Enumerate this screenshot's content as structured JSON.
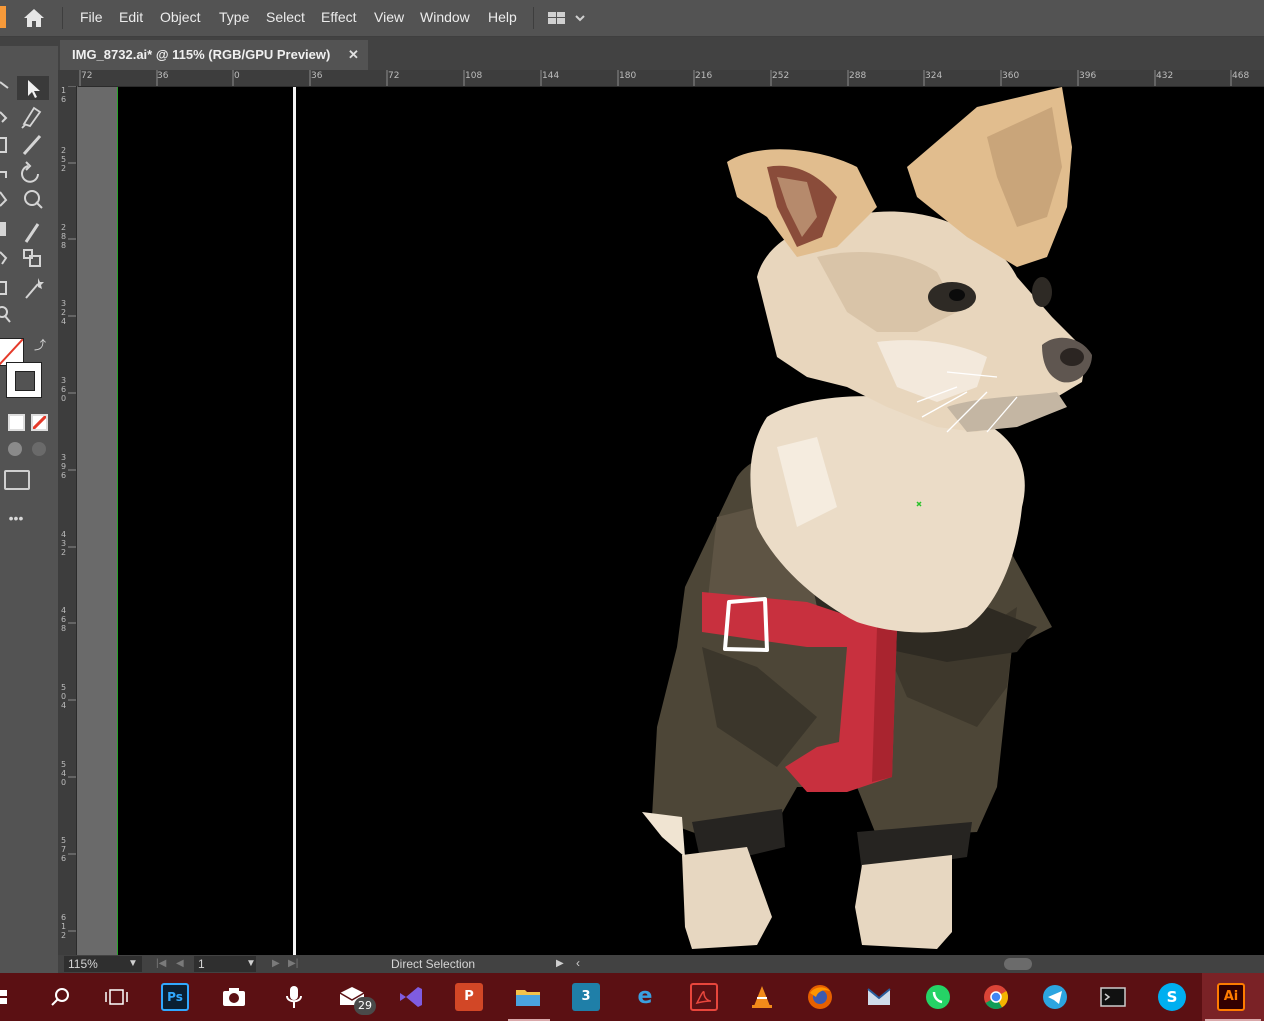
{
  "menubar": {
    "items": [
      "File",
      "Edit",
      "Object",
      "Type",
      "Select",
      "Effect",
      "View",
      "Window",
      "Help"
    ]
  },
  "document": {
    "tab_title": "IMG_8732.ai* @ 115% (RGB/GPU Preview)",
    "close_glyph": "✕"
  },
  "ruler": {
    "top_labels": [
      "72",
      "36",
      "0",
      "36",
      "72",
      "108",
      "144",
      "180",
      "216",
      "252",
      "288",
      "324",
      "360",
      "396",
      "432",
      "468"
    ],
    "left_labels": [
      "1\n6",
      "2\n5\n2",
      "2\n8\n8",
      "3\n2\n4",
      "3\n6\n0",
      "3\n9\n6",
      "4\n3\n2",
      "4\n6\n8",
      "5\n0\n4",
      "5\n4\n0",
      "5\n7\n6",
      "6\n1\n2"
    ]
  },
  "toolbar": {
    "tools": [
      "selection-tool",
      "direct-selection-tool",
      "pen-tool",
      "curvature-tool",
      "rectangle-tool",
      "paintbrush-tool",
      "rotate-tool",
      "scale-tool",
      "width-tool",
      "free-transform-tool",
      "shape-builder-tool",
      "eyedropper-tool",
      "blend-tool",
      "symbol-sprayer-tool",
      "artboard-tool",
      "slice-tool",
      "zoom-tool"
    ],
    "more_label": "•••"
  },
  "status": {
    "zoom": "115%",
    "page": "1",
    "tool_name": "Direct Selection"
  },
  "taskbar": {
    "mail_badge": "29",
    "icons": [
      "windows-start",
      "search",
      "task-view",
      "photoshop",
      "camera",
      "voice-recorder",
      "mail",
      "visual-studio",
      "powerpoint",
      "file-explorer",
      "3d-app",
      "edge",
      "acrobat",
      "vlc",
      "firefox",
      "mail-app",
      "whatsapp",
      "chrome",
      "telegram",
      "terminal",
      "skype",
      "illustrator"
    ]
  },
  "colors": {
    "accent_orange": "#f79a3a",
    "artboard": "#000000",
    "harness_red": "#c8303e",
    "coat_green": "#4d4637",
    "fur_cream": "#ebdcc7",
    "taskbar": "#5b1013"
  }
}
